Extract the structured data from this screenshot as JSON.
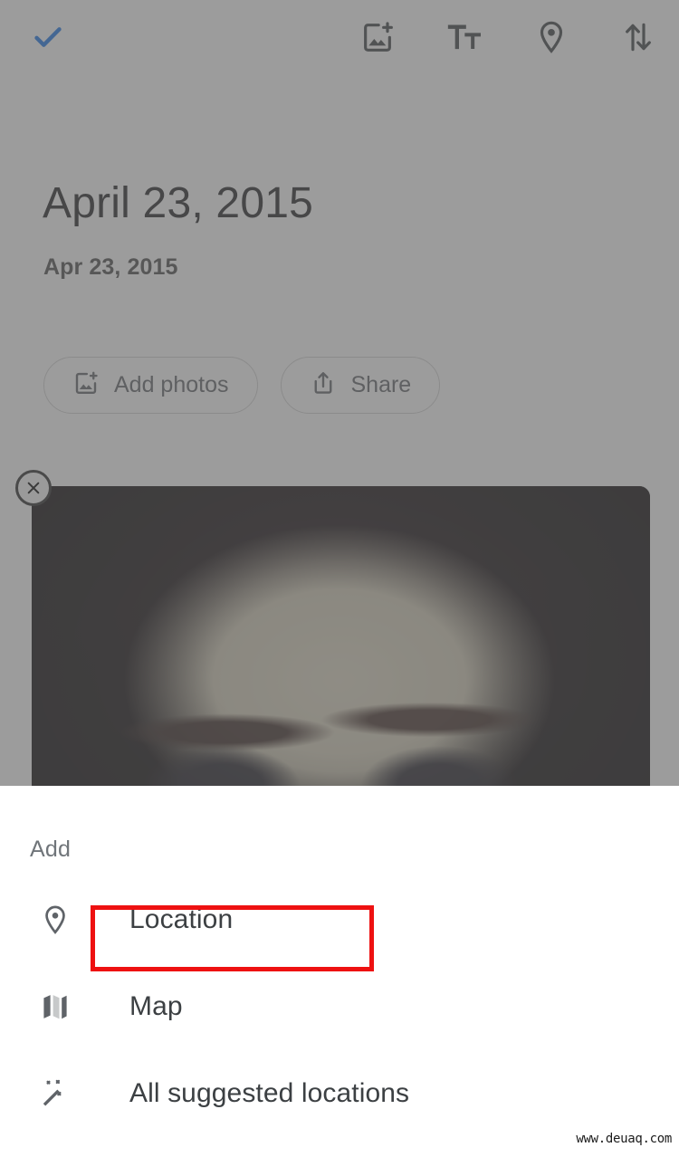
{
  "toolbar": {
    "confirm": {
      "name": "check-icon",
      "label": "Done",
      "color": "#1a73e8"
    },
    "actions": [
      {
        "name": "add-photo-icon",
        "label": "Add photos"
      },
      {
        "name": "text-format-icon",
        "label": "Text style"
      },
      {
        "name": "location-icon",
        "label": "Location"
      },
      {
        "name": "sort-icon",
        "label": "Reorder"
      }
    ]
  },
  "memory": {
    "title": "April 23, 2015",
    "subtitle": "Apr 23, 2015",
    "chips": [
      {
        "icon": "add-photo-icon",
        "label": "Add photos"
      },
      {
        "icon": "share-icon",
        "label": "Share"
      }
    ],
    "photo": {
      "remove_icon": "close-circle-icon",
      "alt": "Close-up portrait photo"
    }
  },
  "sheet": {
    "header": "Add",
    "items": [
      {
        "icon": "location-pin-icon",
        "label": "Location",
        "highlighted": true
      },
      {
        "icon": "map-icon",
        "label": "Map",
        "highlighted": false
      },
      {
        "icon": "magic-wand-icon",
        "label": "All suggested locations",
        "highlighted": false
      }
    ]
  },
  "annotation": {
    "color": "#ee1111"
  },
  "watermark": {
    "text": "www.deuaq.com"
  }
}
